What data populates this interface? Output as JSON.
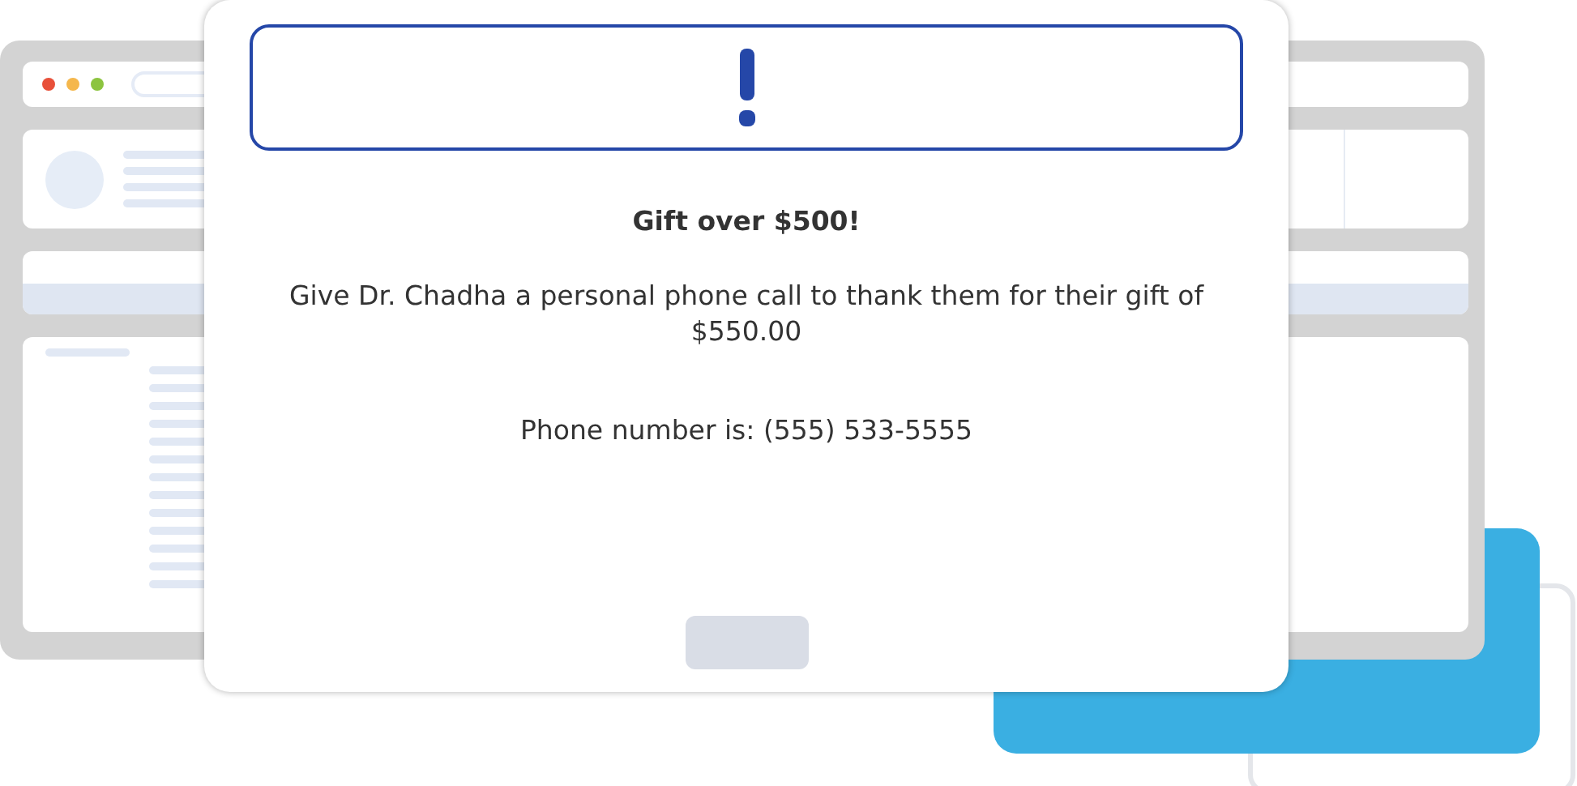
{
  "dialog": {
    "title": "Gift over $500!",
    "message": "Give Dr. Chadha a personal phone call to thank them for their gift of $550.00",
    "phone": "Phone number is: (555) 533-5555"
  }
}
